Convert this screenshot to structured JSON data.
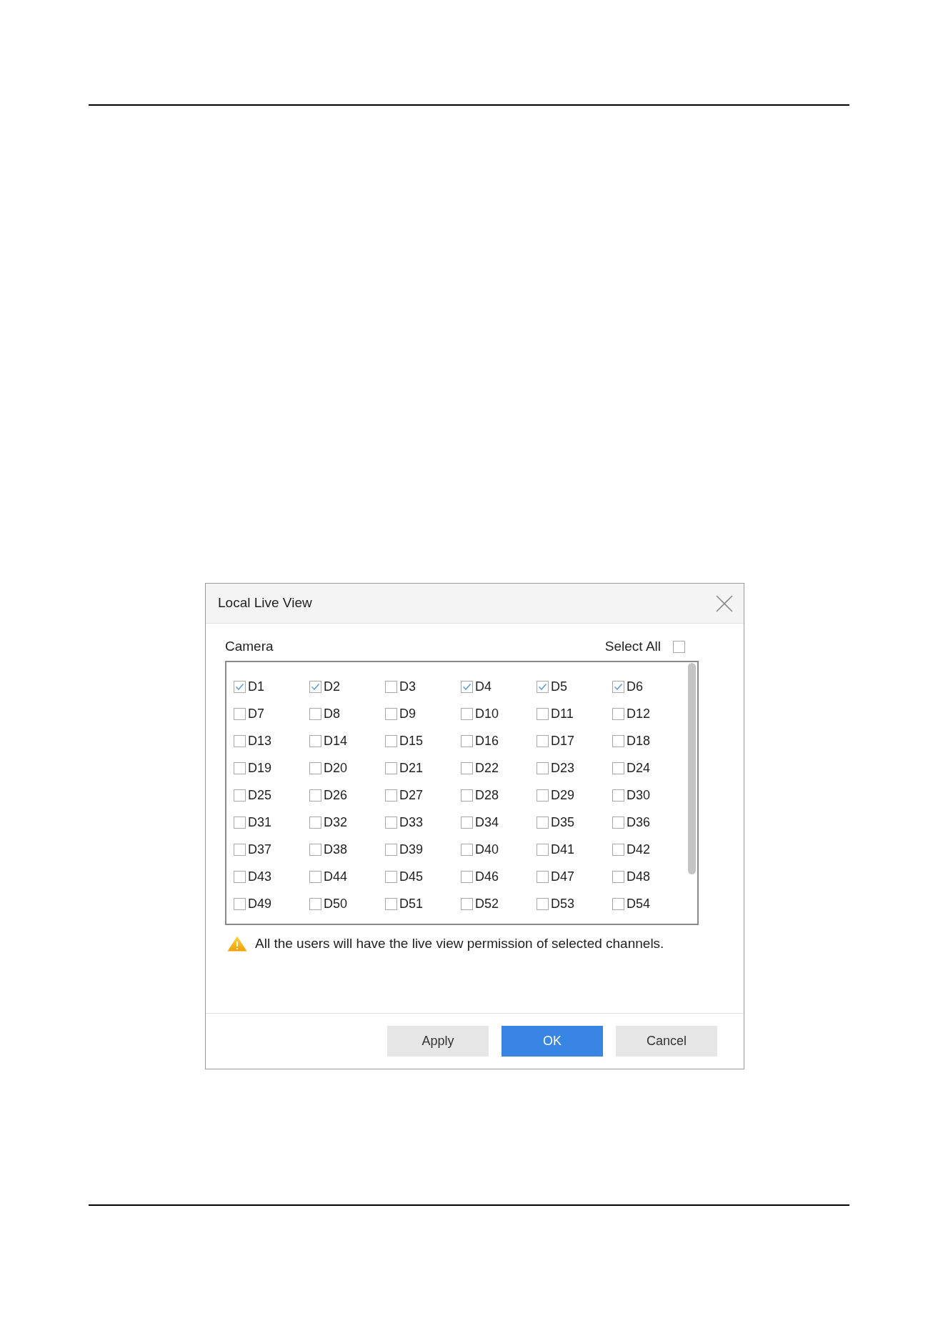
{
  "dialog": {
    "title": "Local Live View",
    "camera_label": "Camera",
    "select_all": {
      "label": "Select All",
      "checked": false
    },
    "channels": [
      {
        "label": "D1",
        "checked": true
      },
      {
        "label": "D2",
        "checked": true
      },
      {
        "label": "D3",
        "checked": false
      },
      {
        "label": "D4",
        "checked": true
      },
      {
        "label": "D5",
        "checked": true
      },
      {
        "label": "D6",
        "checked": true
      },
      {
        "label": "D7",
        "checked": false
      },
      {
        "label": "D8",
        "checked": false
      },
      {
        "label": "D9",
        "checked": false
      },
      {
        "label": "D10",
        "checked": false
      },
      {
        "label": "D11",
        "checked": false
      },
      {
        "label": "D12",
        "checked": false
      },
      {
        "label": "D13",
        "checked": false
      },
      {
        "label": "D14",
        "checked": false
      },
      {
        "label": "D15",
        "checked": false
      },
      {
        "label": "D16",
        "checked": false
      },
      {
        "label": "D17",
        "checked": false
      },
      {
        "label": "D18",
        "checked": false
      },
      {
        "label": "D19",
        "checked": false
      },
      {
        "label": "D20",
        "checked": false
      },
      {
        "label": "D21",
        "checked": false
      },
      {
        "label": "D22",
        "checked": false
      },
      {
        "label": "D23",
        "checked": false
      },
      {
        "label": "D24",
        "checked": false
      },
      {
        "label": "D25",
        "checked": false
      },
      {
        "label": "D26",
        "checked": false
      },
      {
        "label": "D27",
        "checked": false
      },
      {
        "label": "D28",
        "checked": false
      },
      {
        "label": "D29",
        "checked": false
      },
      {
        "label": "D30",
        "checked": false
      },
      {
        "label": "D31",
        "checked": false
      },
      {
        "label": "D32",
        "checked": false
      },
      {
        "label": "D33",
        "checked": false
      },
      {
        "label": "D34",
        "checked": false
      },
      {
        "label": "D35",
        "checked": false
      },
      {
        "label": "D36",
        "checked": false
      },
      {
        "label": "D37",
        "checked": false
      },
      {
        "label": "D38",
        "checked": false
      },
      {
        "label": "D39",
        "checked": false
      },
      {
        "label": "D40",
        "checked": false
      },
      {
        "label": "D41",
        "checked": false
      },
      {
        "label": "D42",
        "checked": false
      },
      {
        "label": "D43",
        "checked": false
      },
      {
        "label": "D44",
        "checked": false
      },
      {
        "label": "D45",
        "checked": false
      },
      {
        "label": "D46",
        "checked": false
      },
      {
        "label": "D47",
        "checked": false
      },
      {
        "label": "D48",
        "checked": false
      },
      {
        "label": "D49",
        "checked": false
      },
      {
        "label": "D50",
        "checked": false
      },
      {
        "label": "D51",
        "checked": false
      },
      {
        "label": "D52",
        "checked": false
      },
      {
        "label": "D53",
        "checked": false
      },
      {
        "label": "D54",
        "checked": false
      }
    ],
    "warning": "All the users will have the live view permission of selected channels.",
    "buttons": [
      {
        "label": "Apply",
        "kind": "secondary"
      },
      {
        "label": "OK",
        "kind": "primary"
      },
      {
        "label": "Cancel",
        "kind": "secondary"
      }
    ]
  }
}
